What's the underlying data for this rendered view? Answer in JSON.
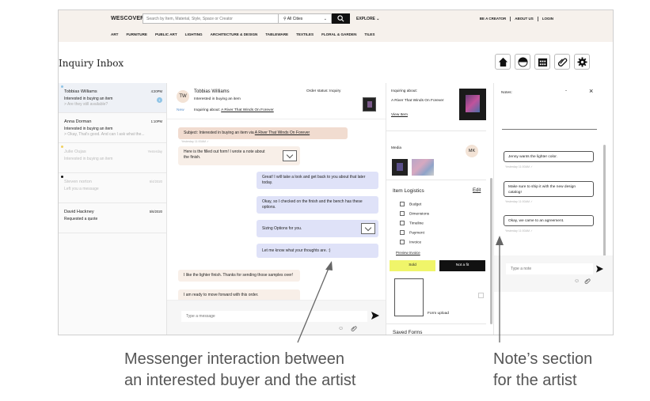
{
  "nav": {
    "logo": "WESCOVER",
    "search_placeholder": "Search by Item, Material, Style, Space or Creator",
    "city": "All Cities",
    "explore": "EXPLORE",
    "links": [
      "BE A CREATOR",
      "ABOUT US",
      "LOGIN"
    ],
    "categories": [
      "ART",
      "FURNITURE",
      "PUBLIC ART",
      "LIGHTING",
      "ARCHITECTURE & DESIGN",
      "TABLEWARE",
      "TEXTILES",
      "FLORAL & GARDEN",
      "TILES"
    ]
  },
  "page": {
    "title": "Inquiry Inbox"
  },
  "toolbar_icons": [
    "home-icon",
    "half-circle-icon",
    "calendar-icon",
    "paperclip-icon",
    "gear-icon"
  ],
  "inbox": [
    {
      "name": "Tobbias Williams",
      "date": "4:20PM",
      "subject": "Interested in buying an item",
      "preview": "> Are they still available?",
      "badge": "1",
      "dot": "#8fc4e6"
    },
    {
      "name": "Anna Dorman",
      "date": "1:10PM",
      "subject": "Interested in buying an item",
      "preview": "> Okay, That's good. And can I ask what the...",
      "badge": "",
      "dot": ""
    },
    {
      "name": "Julie Oujas",
      "date": "Yesterday",
      "subject": "Interested in buying an item",
      "preview": "",
      "badge": "",
      "dot": "#f0d060"
    },
    {
      "name": "Steven norton",
      "date": "6/4/2020",
      "subject": "Left you a message",
      "preview": "",
      "badge": "",
      "dot": "#111111"
    },
    {
      "name": "David Hackney",
      "date": "5/6/2020",
      "subject": "Requested a quote",
      "preview": "",
      "badge": "",
      "dot": ""
    }
  ],
  "conversation": {
    "avatar": "TW",
    "buyer": "Tobbias Williams",
    "buyer_sub": "Interested in buying an item",
    "new_tag": "New",
    "inquiring_label": "Inquiring about:",
    "inquiring_item": "A River That Winds On Forever",
    "order_status": "Order status: Inquiry",
    "subject_prefix": "Subject: Interested in buying an item via ",
    "subject_item": "A River That Winds On Forever",
    "timestamp": "Yesterday 11:00AM ✓",
    "messages": [
      "Here is the filled out form! I wrote a note about the finish.",
      "Great! I will take a look and get back to you about that later today.",
      "Okay, so I checked on the finish and the bench has these options.",
      "Sizing Options for you.",
      "Let me know what your thoughts are. :)",
      "I like the lighter finish. Thanks for sending those samples over!",
      "I am ready to move forward with this order."
    ],
    "input_placeholder": "Type a message"
  },
  "detail": {
    "inquiring_label": "Inquiring about:",
    "item": "A River That Winds On Forever",
    "view_item": "View Item",
    "media_label": "Media",
    "media_avatar": "MK",
    "logistics_title": "Item Logistics",
    "edit": "Edit",
    "checks": [
      "Budget",
      "Dimensions",
      "Timeline",
      "Payment",
      "Invoice"
    ],
    "preview_invoice": "Preview Invoice",
    "sold": "Sold",
    "not_fit": "Not a fit",
    "form_upload": "Form upload",
    "saved_forms": "Saved Forms"
  },
  "notes": {
    "title": "Notes:",
    "dash": "-",
    "items": [
      "Jenny wants the lighter color.",
      "Make sure to ship it with the new design catalog!",
      "Okay, we came to an agreement."
    ],
    "timestamp": "Yesterday 11:00AM ✓",
    "input_placeholder": "Type a note"
  },
  "annotations": {
    "messenger": [
      "Messenger interaction between",
      "an interested buyer and the artist"
    ],
    "notes": [
      "Note’s section",
      "for the artist"
    ]
  },
  "colors": {
    "accent_yellow": "#f0f56a",
    "outgoing_bubble": "#dfe2f8",
    "incoming_bubble": "#f8efe8",
    "subject_bubble": "#f1dcd0",
    "topbar": "#f6f1ec"
  }
}
